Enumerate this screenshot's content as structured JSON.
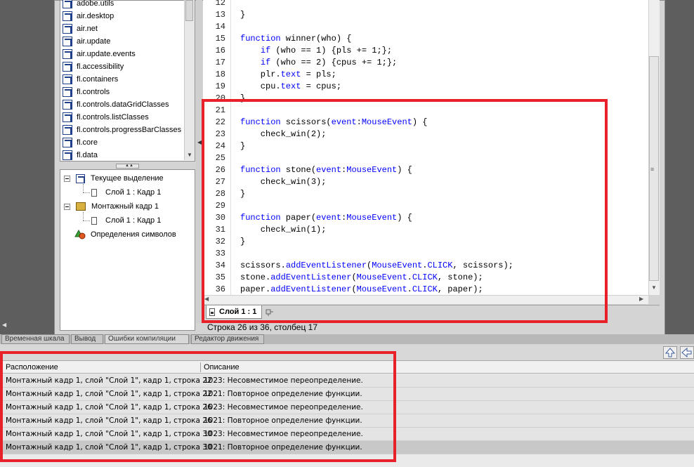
{
  "packages": [
    "adobe.utils",
    "air.desktop",
    "air.net",
    "air.update",
    "air.update.events",
    "fl.accessibility",
    "fl.containers",
    "fl.controls",
    "fl.controls.dataGridClasses",
    "fl.controls.listClasses",
    "fl.controls.progressBarClasses",
    "fl.core",
    "fl.data"
  ],
  "tree": {
    "current_selection": "Текущее выделение",
    "current_layer": "Слой 1 : Кадр 1",
    "scene_frame": "Монтажный кадр 1",
    "scene_layer": "Слой 1 : Кадр 1",
    "symbol_definitions": "Определения символов"
  },
  "code": {
    "lines": [
      {
        "n": "12",
        "t": ""
      },
      {
        "n": "13",
        "t": "}"
      },
      {
        "n": "14",
        "t": ""
      },
      {
        "n": "15",
        "t": "function winner(who) {"
      },
      {
        "n": "16",
        "t": "    if (who == 1) {pls += 1;};"
      },
      {
        "n": "17",
        "t": "    if (who == 2) {cpus += 1;};"
      },
      {
        "n": "18",
        "t": "    plr.text = pls;"
      },
      {
        "n": "19",
        "t": "    cpu.text = cpus;"
      },
      {
        "n": "20",
        "t": "}"
      },
      {
        "n": "21",
        "t": ""
      },
      {
        "n": "22",
        "t": "function scissors(event:MouseEvent) {"
      },
      {
        "n": "23",
        "t": "    check_win(2);"
      },
      {
        "n": "24",
        "t": "}"
      },
      {
        "n": "25",
        "t": ""
      },
      {
        "n": "26",
        "t": "function stone(event:MouseEvent) {"
      },
      {
        "n": "27",
        "t": "    check_win(3);"
      },
      {
        "n": "28",
        "t": "}"
      },
      {
        "n": "29",
        "t": ""
      },
      {
        "n": "30",
        "t": "function paper(event:MouseEvent) {"
      },
      {
        "n": "31",
        "t": "    check_win(1);"
      },
      {
        "n": "32",
        "t": "}"
      },
      {
        "n": "33",
        "t": ""
      },
      {
        "n": "34",
        "t": "scissors.addEventListener(MouseEvent.CLICK, scissors);"
      },
      {
        "n": "35",
        "t": "stone.addEventListener(MouseEvent.CLICK, stone);"
      },
      {
        "n": "36",
        "t": "paper.addEventListener(MouseEvent.CLICK, paper);"
      }
    ]
  },
  "editor_tab": "Слой 1 : 1",
  "status_line": "Строка 26 из 36, столбец 17",
  "panel_tabs": [
    "Временная шкала",
    "Вывод",
    "Ошибки компиляции",
    "Редактор движения"
  ],
  "errors": {
    "col_location": "Расположение",
    "col_description": "Описание",
    "rows": [
      {
        "loc": "Монтажный кадр 1, слой \"Слой 1\", кадр 1, строка 22",
        "desc": "1023: Несовместимое переопределение."
      },
      {
        "loc": "Монтажный кадр 1, слой \"Слой 1\", кадр 1, строка 22",
        "desc": "1021: Повторное определение функции."
      },
      {
        "loc": "Монтажный кадр 1, слой \"Слой 1\", кадр 1, строка 26",
        "desc": "1023: Несовместимое переопределение."
      },
      {
        "loc": "Монтажный кадр 1, слой \"Слой 1\", кадр 1, строка 26",
        "desc": "1021: Повторное определение функции."
      },
      {
        "loc": "Монтажный кадр 1, слой \"Слой 1\", кадр 1, строка 30",
        "desc": "1023: Несовместимое переопределение."
      },
      {
        "loc": "Монтажный кадр 1, слой \"Слой 1\", кадр 1, строка 30",
        "desc": "1021: Повторное определение функции."
      }
    ]
  },
  "colors": {
    "highlight": "#e8202a",
    "keyword": "#0000ff"
  }
}
